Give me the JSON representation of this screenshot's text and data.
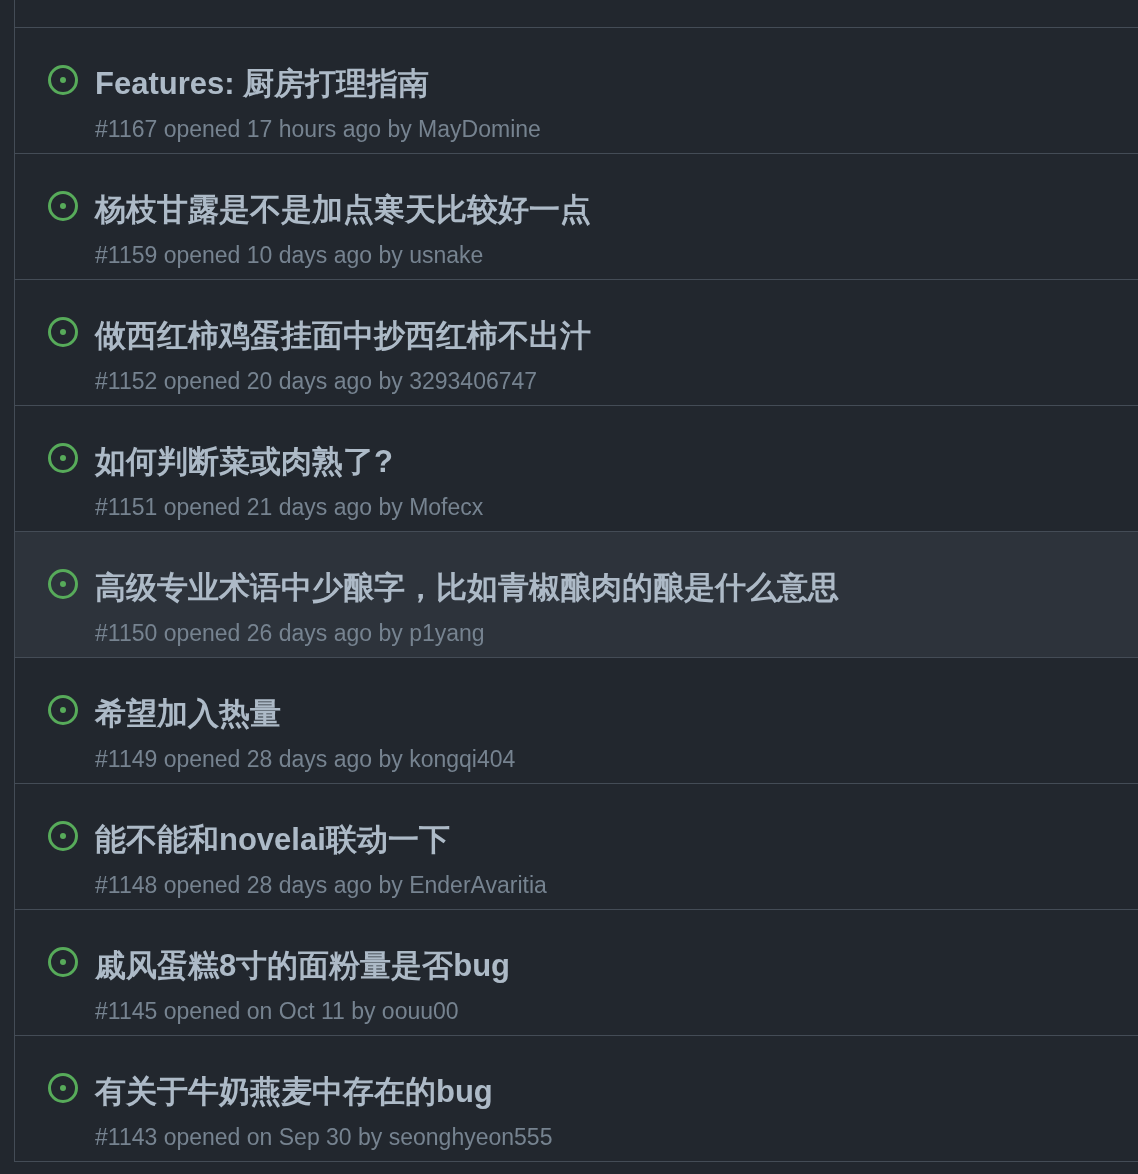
{
  "issues": [
    {
      "title": "Features: 厨房打理指南",
      "meta": "#1167 opened 17 hours ago by MayDomine",
      "hovered": false
    },
    {
      "title": "杨枝甘露是不是加点寒天比较好一点",
      "meta": "#1159 opened 10 days ago by usnake",
      "hovered": false
    },
    {
      "title": "做西红柿鸡蛋挂面中抄西红柿不出汁",
      "meta": "#1152 opened 20 days ago by 3293406747",
      "hovered": false
    },
    {
      "title": "如何判断菜或肉熟了?",
      "meta": "#1151 opened 21 days ago by Mofecx",
      "hovered": false
    },
    {
      "title": "高级专业术语中少酿字，比如青椒酿肉的酿是什么意思",
      "meta": "#1150 opened 26 days ago by p1yang",
      "hovered": true
    },
    {
      "title": "希望加入热量",
      "meta": "#1149 opened 28 days ago by kongqi404",
      "hovered": false
    },
    {
      "title": "能不能和novelai联动一下",
      "meta": "#1148 opened 28 days ago by EnderAvaritia",
      "hovered": false
    },
    {
      "title": "戚风蛋糕8寸的面粉量是否bug",
      "meta": "#1145 opened on Oct 11 by oouu00",
      "hovered": false
    },
    {
      "title": "有关于牛奶燕麦中存在的bug",
      "meta": "#1143 opened on Sep 30 by seonghyeon555",
      "hovered": false
    }
  ]
}
